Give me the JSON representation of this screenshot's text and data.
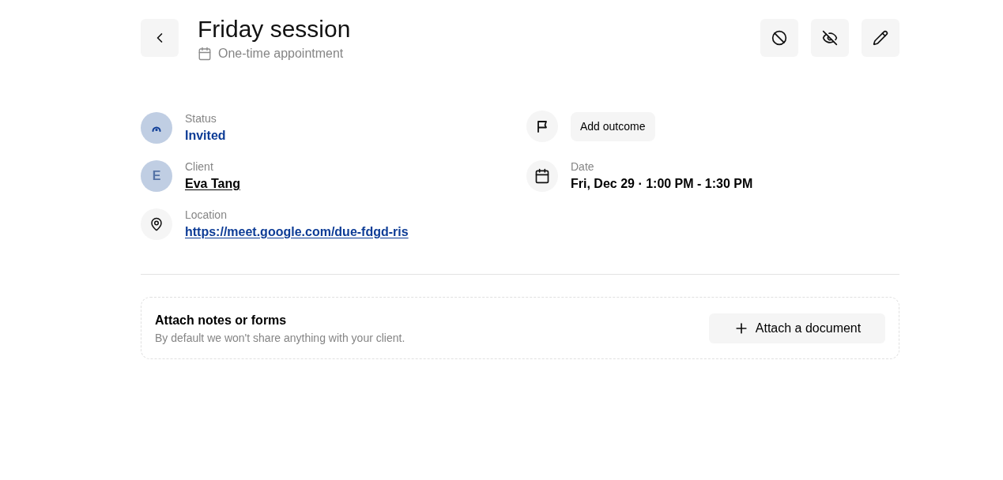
{
  "header": {
    "title": "Friday session",
    "subtitle": "One-time appointment"
  },
  "details_left": [
    {
      "kind": "status",
      "label": "Status",
      "value": "Invited"
    },
    {
      "kind": "client",
      "label": "Client",
      "value": "Eva Tang",
      "avatar": "E"
    },
    {
      "kind": "location",
      "label": "Location",
      "value": "https://meet.google.com/due-fdgd-ris"
    }
  ],
  "details_right": [
    {
      "kind": "outcome",
      "button": "Add outcome"
    },
    {
      "kind": "date",
      "label": "Date",
      "value": "Fri, Dec 29 · 1:00 PM - 1:30 PM"
    }
  ],
  "attach": {
    "title": "Attach notes or forms",
    "description": "By default we won't share anything with your client.",
    "button": "Attach a document"
  }
}
